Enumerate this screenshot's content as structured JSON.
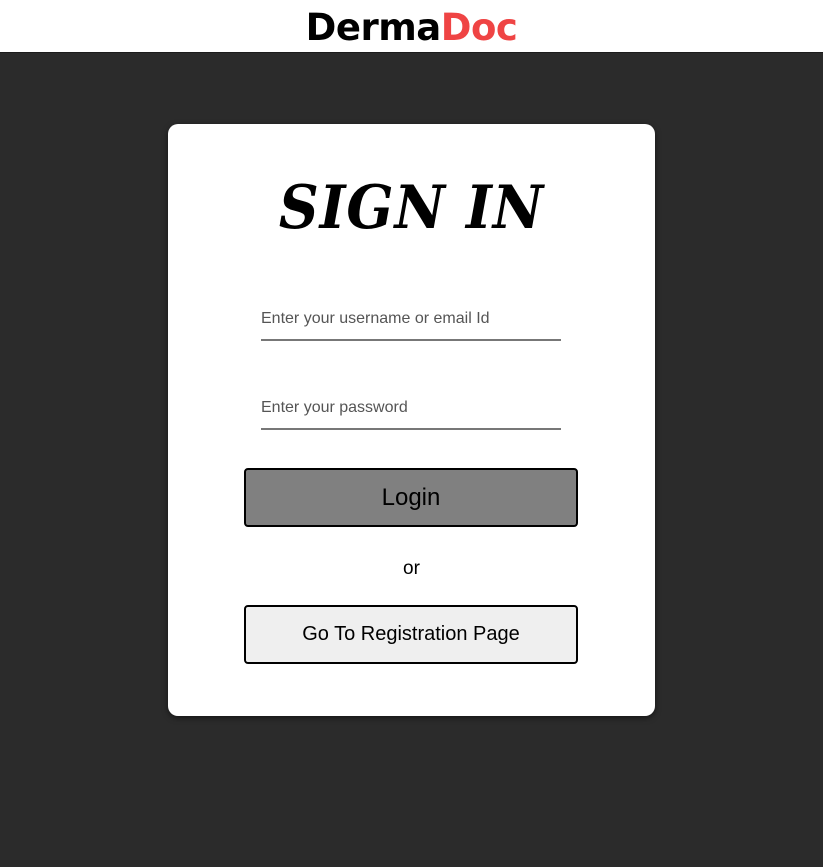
{
  "header": {
    "brand_part1": "Derma",
    "brand_part2": "Doc",
    "brand_colors": {
      "part1": "#000000",
      "part2": "#ef4444"
    }
  },
  "login_card": {
    "title": "SIGN IN",
    "username_field": {
      "value": "",
      "placeholder": "Enter your username or email Id"
    },
    "password_field": {
      "value": "",
      "placeholder": "Enter your password"
    },
    "login_button_label": "Login",
    "separator_text": "or",
    "register_button_label": "Go To Registration Page"
  },
  "colors": {
    "page_background": "#2b2b2b",
    "card_background": "#ffffff",
    "login_button_background": "#808080",
    "register_button_background": "#efefef"
  }
}
